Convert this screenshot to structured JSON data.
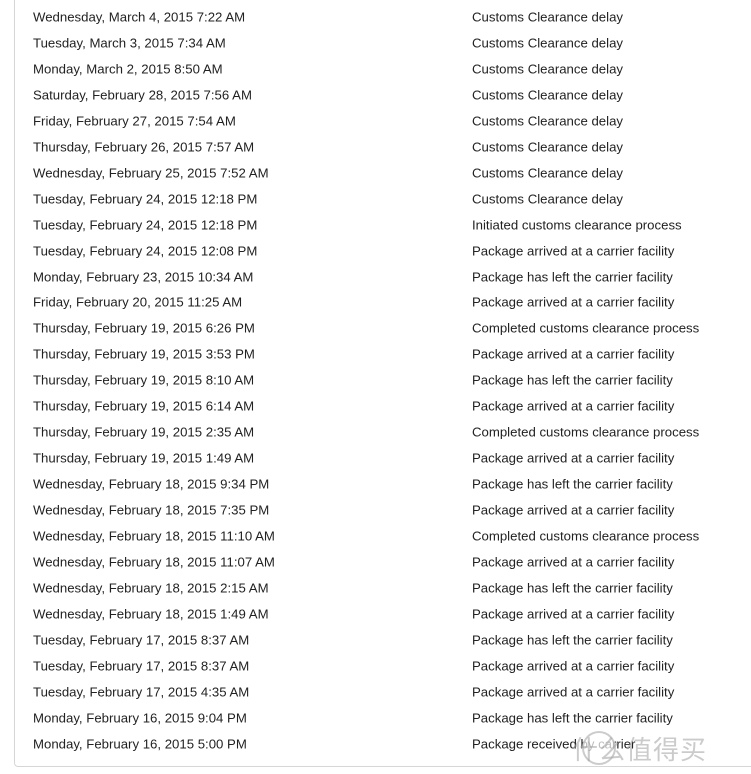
{
  "tracking_events": [
    {
      "date": "Wednesday, March 4, 2015 7:22 AM",
      "activity": "Customs Clearance delay"
    },
    {
      "date": "Tuesday, March 3, 2015 7:34 AM",
      "activity": "Customs Clearance delay"
    },
    {
      "date": "Monday, March 2, 2015 8:50 AM",
      "activity": "Customs Clearance delay"
    },
    {
      "date": "Saturday, February 28, 2015 7:56 AM",
      "activity": "Customs Clearance delay"
    },
    {
      "date": "Friday, February 27, 2015 7:54 AM",
      "activity": "Customs Clearance delay"
    },
    {
      "date": "Thursday, February 26, 2015 7:57 AM",
      "activity": "Customs Clearance delay"
    },
    {
      "date": "Wednesday, February 25, 2015 7:52 AM",
      "activity": "Customs Clearance delay"
    },
    {
      "date": "Tuesday, February 24, 2015 12:18 PM",
      "activity": "Customs Clearance delay"
    },
    {
      "date": "Tuesday, February 24, 2015 12:18 PM",
      "activity": "Initiated customs clearance process"
    },
    {
      "date": "Tuesday, February 24, 2015 12:08 PM",
      "activity": "Package arrived at a carrier facility"
    },
    {
      "date": "Monday, February 23, 2015 10:34 AM",
      "activity": "Package has left the carrier facility"
    },
    {
      "date": "Friday, February 20, 2015 11:25 AM",
      "activity": "Package arrived at a carrier facility"
    },
    {
      "date": "Thursday, February 19, 2015 6:26 PM",
      "activity": "Completed customs clearance process"
    },
    {
      "date": "Thursday, February 19, 2015 3:53 PM",
      "activity": "Package arrived at a carrier facility"
    },
    {
      "date": "Thursday, February 19, 2015 8:10 AM",
      "activity": "Package has left the carrier facility"
    },
    {
      "date": "Thursday, February 19, 2015 6:14 AM",
      "activity": "Package arrived at a carrier facility"
    },
    {
      "date": "Thursday, February 19, 2015 2:35 AM",
      "activity": "Completed customs clearance process"
    },
    {
      "date": "Thursday, February 19, 2015 1:49 AM",
      "activity": "Package arrived at a carrier facility"
    },
    {
      "date": "Wednesday, February 18, 2015 9:34 PM",
      "activity": "Package has left the carrier facility"
    },
    {
      "date": "Wednesday, February 18, 2015 7:35 PM",
      "activity": "Package arrived at a carrier facility"
    },
    {
      "date": "Wednesday, February 18, 2015 11:10 AM",
      "activity": "Completed customs clearance process"
    },
    {
      "date": "Wednesday, February 18, 2015 11:07 AM",
      "activity": "Package arrived at a carrier facility"
    },
    {
      "date": "Wednesday, February 18, 2015 2:15 AM",
      "activity": "Package has left the carrier facility"
    },
    {
      "date": "Wednesday, February 18, 2015 1:49 AM",
      "activity": "Package arrived at a carrier facility"
    },
    {
      "date": "Tuesday, February 17, 2015 8:37 AM",
      "activity": "Package has left the carrier facility"
    },
    {
      "date": "Tuesday, February 17, 2015 8:37 AM",
      "activity": "Package arrived at a carrier facility"
    },
    {
      "date": "Tuesday, February 17, 2015 4:35 AM",
      "activity": "Package arrived at a carrier facility"
    },
    {
      "date": "Monday, February 16, 2015 9:04 PM",
      "activity": "Package has left the carrier facility"
    },
    {
      "date": "Monday, February 16, 2015 5:00 PM",
      "activity": "Package received by carrier"
    }
  ],
  "watermark": {
    "text": "什么值得买"
  }
}
